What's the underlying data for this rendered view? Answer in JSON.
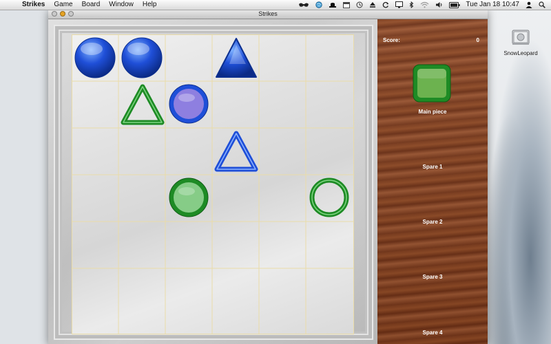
{
  "menubar": {
    "apple_icon": "apple-icon",
    "app_name": "Strikes",
    "menus": [
      "Game",
      "Board",
      "Window",
      "Help"
    ],
    "datetime": "Tue Jan 18  10:47"
  },
  "window": {
    "title": "Strikes"
  },
  "sidebar": {
    "score_label": "Score:",
    "score_value": "0",
    "main_piece_label": "Main piece",
    "spare_labels": [
      "Spare 1",
      "Spare 2",
      "Spare 3",
      "Spare 4"
    ],
    "main_piece": {
      "shape": "square-filled",
      "color": "green"
    }
  },
  "desktop": {
    "drive_label": "SnowLeopard"
  },
  "board": {
    "pieces": [
      {
        "shape": "circle-filled",
        "color": "blue"
      },
      {
        "shape": "circle-filled",
        "color": "blue"
      },
      {
        "shape": "triangle-filled",
        "color": "blue"
      },
      {
        "shape": "triangle-outline",
        "color": "green"
      },
      {
        "shape": "circle-purple-fill",
        "color": "blue"
      },
      {
        "shape": "triangle-outline",
        "color": "blue"
      },
      {
        "shape": "circle-green-fill",
        "color": "green"
      },
      {
        "shape": "circle-outline",
        "color": "green"
      }
    ]
  },
  "colors": {
    "blue": "#1f4fd8",
    "green": "#1e8b25",
    "purple": "#8e7fe0"
  }
}
